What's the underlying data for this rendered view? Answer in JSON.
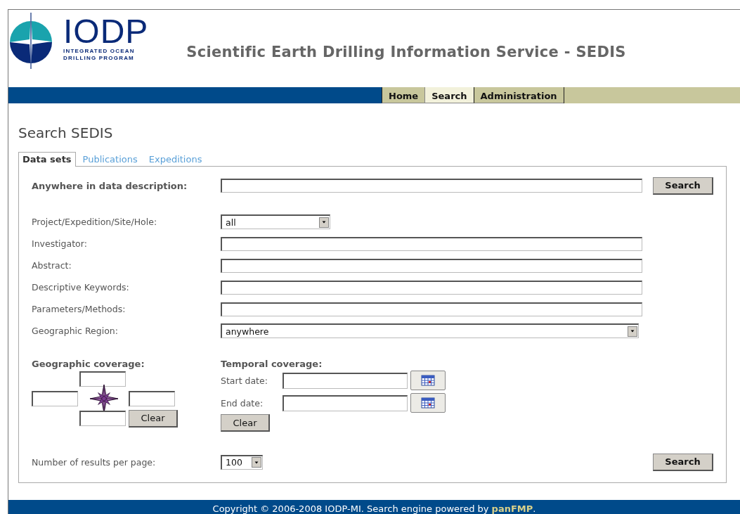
{
  "header": {
    "logo_title": "IODP",
    "logo_line_1": "INTEGRATED OCEAN",
    "logo_line_2": "DRILLING PROGRAM",
    "site_title": "Scientific Earth Drilling Information Service - SEDIS"
  },
  "nav_tabs": [
    {
      "label": "Home",
      "selected": false
    },
    {
      "label": "Search",
      "selected": true
    },
    {
      "label": "Administration",
      "selected": false
    }
  ],
  "page_title": "Search SEDIS",
  "tabs": [
    {
      "label": "Data sets",
      "selected": true
    },
    {
      "label": "Publications",
      "selected": false
    },
    {
      "label": "Expeditions",
      "selected": false
    }
  ],
  "form": {
    "main_search": {
      "label": "Anywhere in data description:",
      "button": "Search"
    },
    "fields": [
      {
        "kind": "select",
        "wide": false,
        "label": "Project/Expedition/Site/Hole:",
        "value": "all"
      },
      {
        "kind": "text",
        "label": "Investigator:"
      },
      {
        "kind": "text",
        "label": "Abstract:"
      },
      {
        "kind": "text",
        "label": "Descriptive Keywords:"
      },
      {
        "kind": "text",
        "label": "Parameters/Methods:"
      },
      {
        "kind": "select",
        "wide": true,
        "label": "Geographic Region:",
        "value": "anywhere"
      }
    ],
    "geographic": {
      "title": "Geographic coverage:",
      "clear": "Clear"
    },
    "temporal": {
      "title": "Temporal coverage:",
      "start_label": "Start date:",
      "end_label": "End date:",
      "clear": "Clear"
    },
    "results": {
      "label": "Number of results per page:",
      "value": "100",
      "button": "Search"
    }
  },
  "footer": {
    "text": "Copyright © 2006-2008 IODP-MI. Search engine powered by ",
    "link": "panFMP",
    "end": "."
  }
}
